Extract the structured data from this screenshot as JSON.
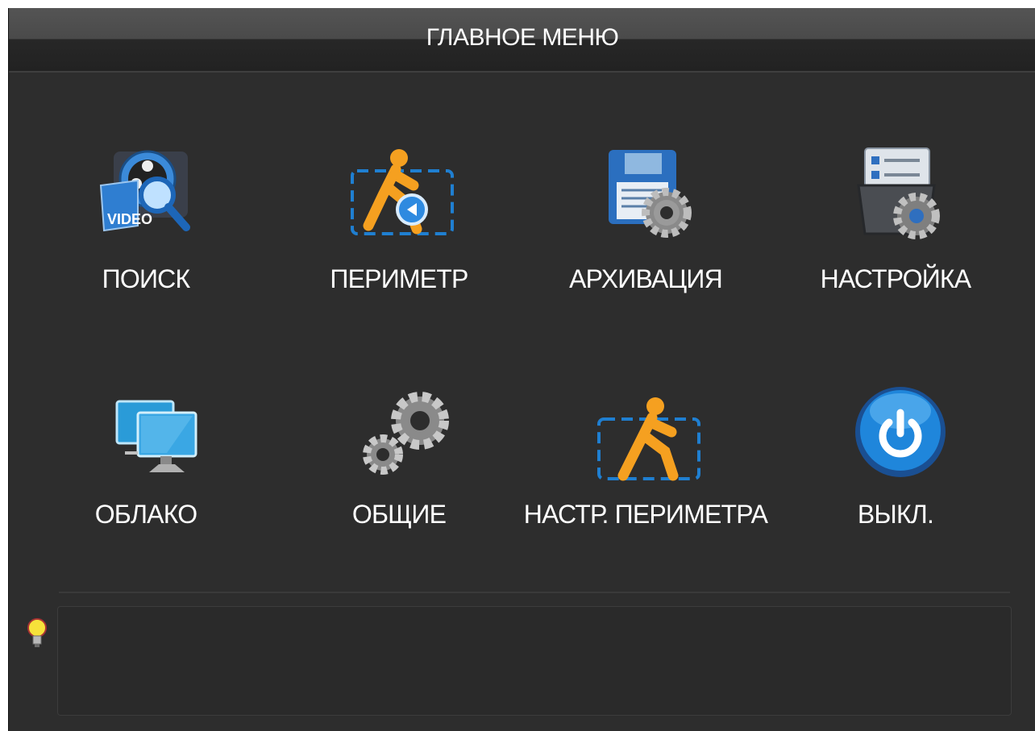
{
  "window": {
    "title": "ГЛАВНОЕ МЕНЮ"
  },
  "menu": {
    "items": [
      {
        "label": "ПОИСК",
        "icon": "video-search-icon"
      },
      {
        "label": "ПЕРИМЕТР",
        "icon": "perimeter-playback-icon"
      },
      {
        "label": "АРХИВАЦИЯ",
        "icon": "backup-disk-icon"
      },
      {
        "label": "НАСТРОЙКА",
        "icon": "settings-checklist-icon"
      },
      {
        "label": "ОБЛАКО",
        "icon": "network-monitors-icon"
      },
      {
        "label": "ОБЩИЕ",
        "icon": "gears-icon"
      },
      {
        "label": "НАСТР. ПЕРИМЕТРА",
        "icon": "perimeter-setup-icon"
      },
      {
        "label": "ВЫКЛ.",
        "icon": "power-icon"
      }
    ]
  },
  "hint": {
    "icon": "lightbulb-icon",
    "text": ""
  },
  "colors": {
    "background": "#2d2d2d",
    "accent_blue": "#1f7fd1",
    "figure_orange": "#f5a020"
  }
}
